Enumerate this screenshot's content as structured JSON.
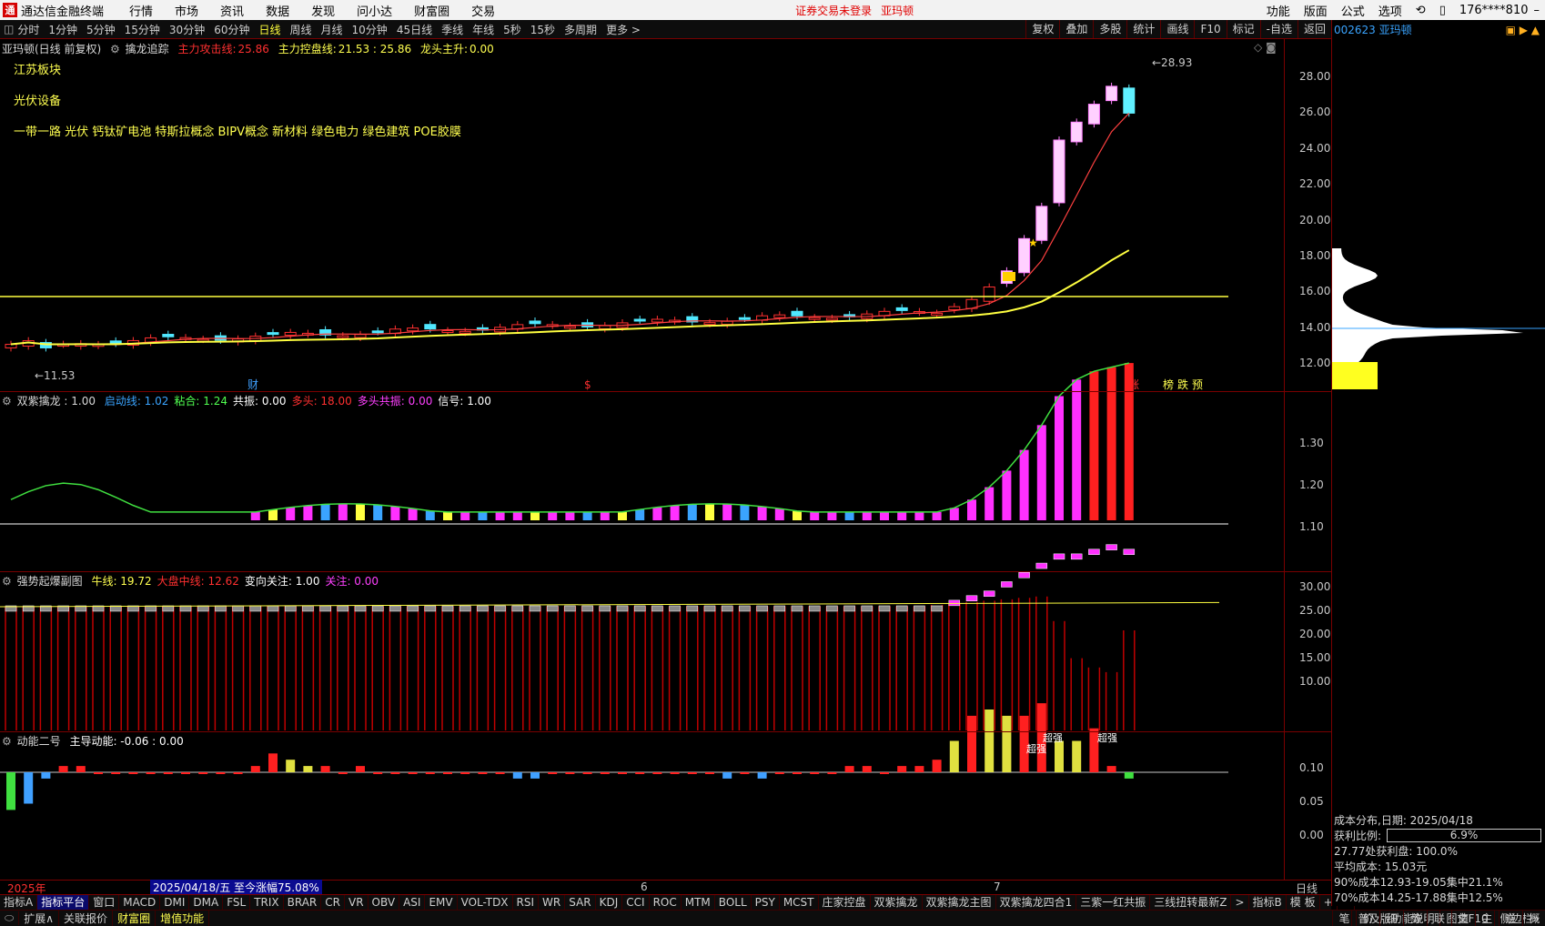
{
  "topbar": {
    "app_title": "通达信金融终端",
    "menus": [
      "行情",
      "市场",
      "资讯",
      "数据",
      "发现",
      "问小达",
      "财富圈",
      "交易"
    ],
    "warning": "证券交易未登录",
    "stock_name": "亚玛顿",
    "right_menus": [
      "功能",
      "版面",
      "公式",
      "选项"
    ],
    "user": "176****810"
  },
  "periods": [
    "分时",
    "1分钟",
    "5分钟",
    "15分钟",
    "30分钟",
    "60分钟",
    "日线",
    "周线",
    "月线",
    "10分钟",
    "45日线",
    "季线",
    "年线",
    "5秒",
    "15秒",
    "多周期",
    "更多 >"
  ],
  "active_period": "日线",
  "right_tools": [
    "复权",
    "叠加",
    "多股",
    "统计",
    "画线",
    "F10",
    "标记",
    "-自选",
    "返回"
  ],
  "main_panel": {
    "title": "亚玛顿(日线 前复权)",
    "indicator": "擒龙追踪",
    "line1_label": "主力攻击线:",
    "line1_value": "25.86",
    "line2_label": "主力控盘线:",
    "line2_value": "21.53 : 25.86",
    "line3_label": "龙头主升:",
    "line3_value": "0.00",
    "concepts": [
      "江苏板块",
      "光伏设备",
      "一带一路 光伏 钙钛矿电池 特斯拉概念 BIPV概念 新材料 绿色电力 绿色建筑 POE胶膜"
    ],
    "low_label": "11.53",
    "high_label": "28.93",
    "markers": {
      "cai": "财",
      "dollar": "$",
      "zhang": "涨",
      "bang": "榜",
      "die": "跌",
      "yu": "预"
    },
    "y_ticks": [
      "28.00",
      "26.00",
      "24.00",
      "22.00",
      "20.00",
      "18.00",
      "16.00",
      "14.00",
      "12.00"
    ]
  },
  "panel2": {
    "title": "双紫擒龙 : 1.00",
    "items": [
      {
        "label": "启动线:",
        "value": "1.02",
        "color": "#3aa4ff"
      },
      {
        "label": "粘合:",
        "value": "1.24",
        "color": "#50ff50"
      },
      {
        "label": "共振:",
        "value": "0.00",
        "color": "#ffffff"
      },
      {
        "label": "多头:",
        "value": "18.00",
        "color": "#ff3030"
      },
      {
        "label": "多头共振:",
        "value": "0.00",
        "color": "#ff40ff"
      },
      {
        "label": "信号:",
        "value": "1.00",
        "color": "#ffffff"
      }
    ],
    "y_ticks": [
      "1.30",
      "1.20",
      "1.10"
    ]
  },
  "panel3": {
    "title": "强势起爆副图",
    "items": [
      {
        "label": "牛线:",
        "value": "19.72",
        "color": "#ffff50"
      },
      {
        "label": "大盘中线:",
        "value": "12.62",
        "color": "#ff3030"
      },
      {
        "label": "变向关注:",
        "value": "1.00",
        "color": "#ffffff"
      },
      {
        "label": "关注:",
        "value": "0.00",
        "color": "#ff40ff"
      }
    ],
    "y_ticks": [
      "30.00",
      "25.00",
      "20.00",
      "15.00",
      "10.00"
    ]
  },
  "panel4": {
    "title": "动能二号",
    "items": [
      {
        "label": "主导动能:",
        "value": "-0.06 : 0.00",
        "color": "#ffffff"
      }
    ],
    "y_ticks": [
      "0.10",
      "0.05",
      "0.00"
    ],
    "labels": [
      "超强",
      "超强",
      "超强"
    ]
  },
  "time_axis": {
    "year": "2025年",
    "cursor": "2025/04/18/五  至今涨幅75.08%",
    "month6": "6",
    "month7": "7",
    "period_label": "日线"
  },
  "right_panel": {
    "code": "002623 亚玛顿",
    "cost_date": "成本分布,日期: 2025/04/18",
    "profit_label": "获利比例:",
    "profit_value": "6.9%",
    "profit_line": "27.77处获利盘: 100.0%",
    "avg_cost": "平均成本: 15.03元",
    "cost90": "90%成本12.93-19.05集中21.1%",
    "cost70": "70%成本14.25-17.88集中12.5%",
    "bottom_tabs": [
      "笔",
      "价",
      "细",
      "势",
      "联",
      "值",
      "主",
      "逆",
      "概"
    ]
  },
  "bottom_tabs": [
    "指标A",
    "指标平台",
    "窗口",
    "MACD",
    "DMI",
    "DMA",
    "FSL",
    "TRIX",
    "BRAR",
    "CR",
    "VR",
    "OBV",
    "ASI",
    "EMV",
    "VOL-TDX",
    "RSI",
    "WR",
    "SAR",
    "KDJ",
    "CCI",
    "ROC",
    "MTM",
    "BOLL",
    "PSY",
    "MCST",
    "庄家控盘",
    "双紫擒龙",
    "双紫擒龙主图",
    "双紫擒龙四合1",
    "三紫一红共振",
    "三线扭转最新Z",
    ">",
    "指标B",
    "模 板",
    "+",
    "−"
  ],
  "active_tab": "指标平台",
  "status": {
    "items": [
      "扩展∧",
      "关联报价",
      "财富圈",
      "增值功能"
    ],
    "right": [
      "普及版功能说明",
      "图文F10",
      "侧边栏»"
    ]
  },
  "colors": {
    "up": "#ff3030",
    "down": "#50e8ff",
    "ma_fast": "#ff4040",
    "ma_slow": "#ffff40",
    "magenta": "#ff30ff",
    "border": "#7a0000"
  }
}
